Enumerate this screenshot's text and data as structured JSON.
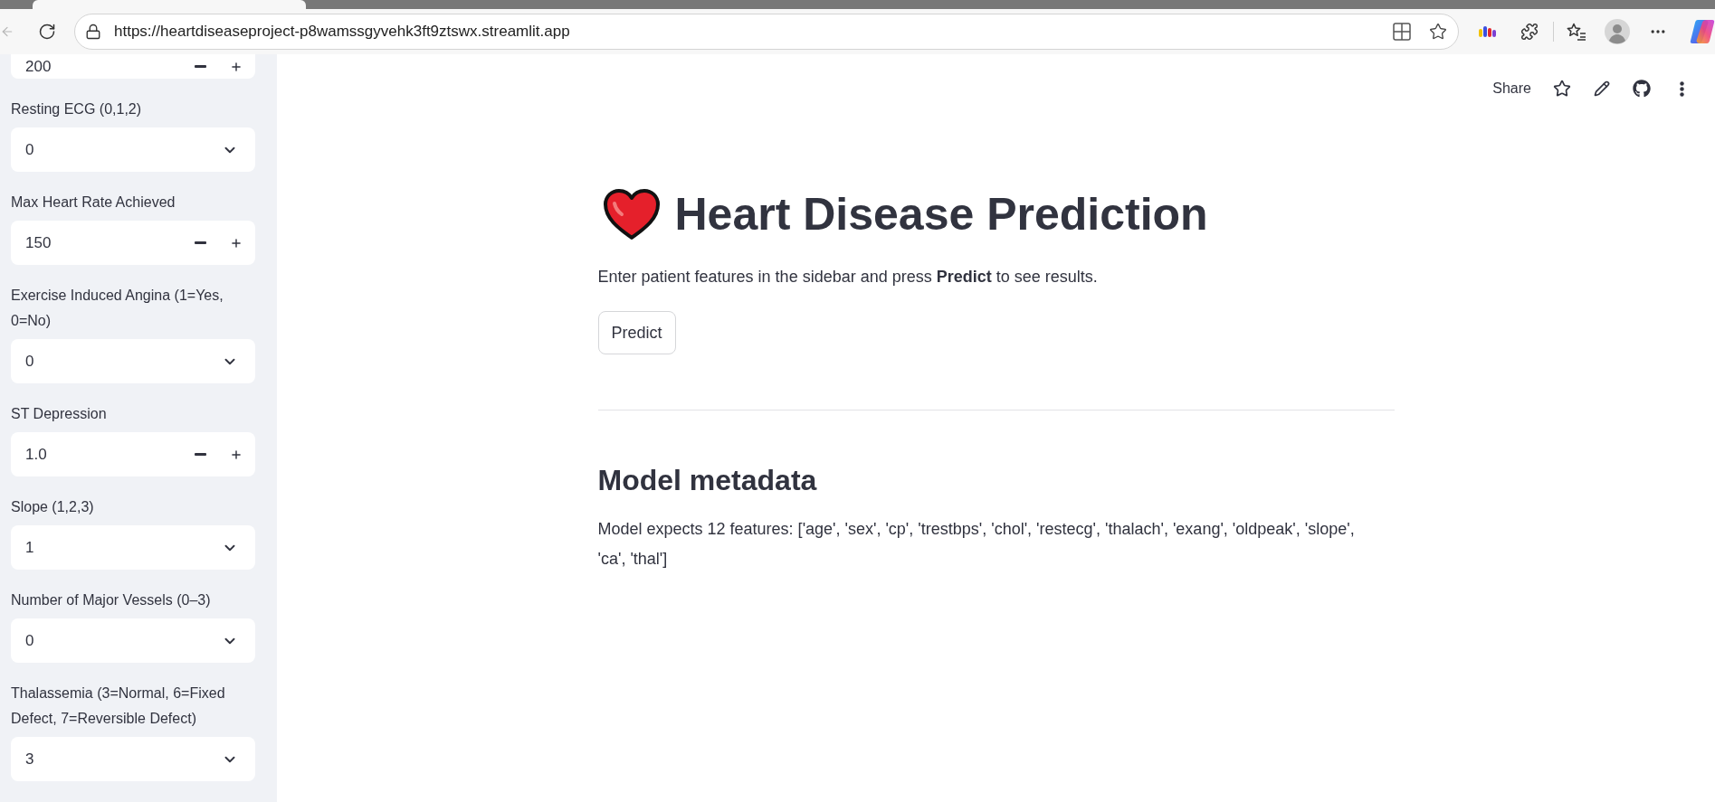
{
  "browser": {
    "url": "https://heartdiseaseproject-p8wamssgyvehk3ft9ztswx.streamlit.app"
  },
  "toolbar": {
    "share": "Share"
  },
  "sidebar": {
    "fields": [
      {
        "kind": "number",
        "value": "200"
      },
      {
        "kind": "select",
        "label": "Resting ECG (0,1,2)",
        "value": "0"
      },
      {
        "kind": "number",
        "label": "Max Heart Rate Achieved",
        "value": "150"
      },
      {
        "kind": "select",
        "label": "Exercise Induced Angina (1=Yes, 0=No)",
        "value": "0"
      },
      {
        "kind": "number",
        "label": "ST Depression",
        "value": "1.0"
      },
      {
        "kind": "select",
        "label": "Slope (1,2,3)",
        "value": "1"
      },
      {
        "kind": "select",
        "label": "Number of Major Vessels (0–3)",
        "value": "0"
      },
      {
        "kind": "select",
        "label": "Thalassemia (3=Normal, 6=Fixed Defect, 7=Reversible Defect)",
        "value": "3"
      }
    ]
  },
  "main": {
    "title": "Heart Disease Prediction",
    "intro": "Enter patient features in the sidebar and press **Predict** to see results.",
    "button": "Predict",
    "section_title": "Model metadata",
    "metadata": "Model expects 12 features: ['age', 'sex', 'cp', 'trestbps', 'chol', 'restecg', 'thalach', 'exang', 'oldpeak', 'slope', 'ca', 'thal']"
  }
}
